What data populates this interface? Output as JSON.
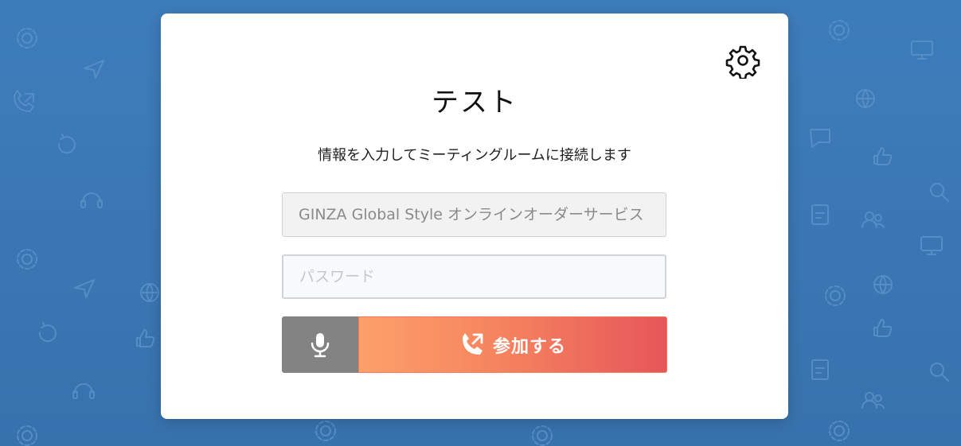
{
  "colors": {
    "background": "#3b77b4",
    "card": "#ffffff",
    "mic_button": "#838383",
    "join_gradient_start": "#fda06a",
    "join_gradient_end": "#e6565a"
  },
  "header": {
    "title": "テスト",
    "settings_icon": "gear-icon"
  },
  "main": {
    "subtitle": "情報を入力してミーティングルームに接続します",
    "room_name": {
      "value": "GINZA Global Style オンラインオーダーサービス"
    },
    "password": {
      "value": "",
      "placeholder": "パスワード"
    },
    "mic_button": {
      "icon": "microphone-icon"
    },
    "join_button": {
      "icon": "phone-outgoing-icon",
      "label": "参加する"
    }
  }
}
